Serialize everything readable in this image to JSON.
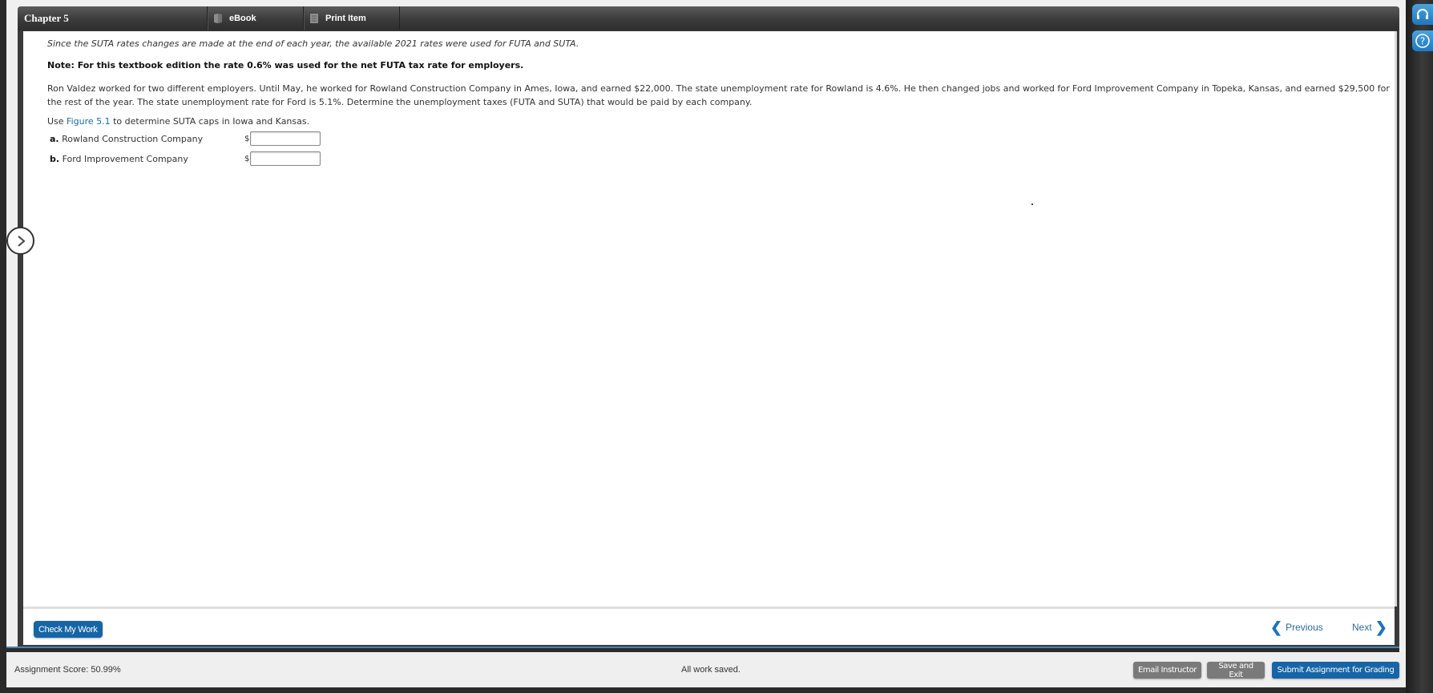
{
  "header": {
    "chapter_title": "Chapter 5",
    "tabs": [
      {
        "label": "eBook",
        "icon": "book-icon"
      },
      {
        "label": "Print Item",
        "icon": "print-icon"
      }
    ]
  },
  "question": {
    "intro_italic": "Since the SUTA rates changes are made at the end of each year, the available 2021 rates were used for FUTA and SUTA.",
    "note_bold": "Note: For this textbook edition the rate 0.6% was used for the net FUTA tax rate for employers.",
    "body": "Ron Valdez worked for two different employers. Until May, he worked for Rowland Construction Company in Ames, Iowa, and earned $22,000. The state unemployment rate for Rowland is 4.6%. He then changed jobs and worked for Ford Improvement Company in Topeka, Kansas, and earned $29,500 for the rest of the year. The state unemployment rate for Ford is 5.1%. Determine the unemployment taxes (FUTA and SUTA) that would be paid by each company.",
    "use_prefix": "Use ",
    "use_link": "Figure 5.1",
    "use_suffix": " to determine SUTA caps in Iowa and Kansas.",
    "parts": [
      {
        "letter": "a.",
        "label": "Rowland Construction Company",
        "currency": "$",
        "value": ""
      },
      {
        "letter": "b.",
        "label": "Ford Improvement Company",
        "currency": "$",
        "value": ""
      }
    ]
  },
  "footer": {
    "check_button": "Check My Work",
    "previous": "Previous",
    "next": "Next"
  },
  "status": {
    "score": "Assignment Score: 50.99%",
    "saved": "All work saved.",
    "email_button": "Email Instructor",
    "save_exit_button": "Save and Exit",
    "submit_button": "Submit Assignment for Grading"
  },
  "colors": {
    "accent_blue": "#1665a6",
    "link_blue": "#1a6aaa",
    "secondary_gray": "#7a7a7a"
  }
}
